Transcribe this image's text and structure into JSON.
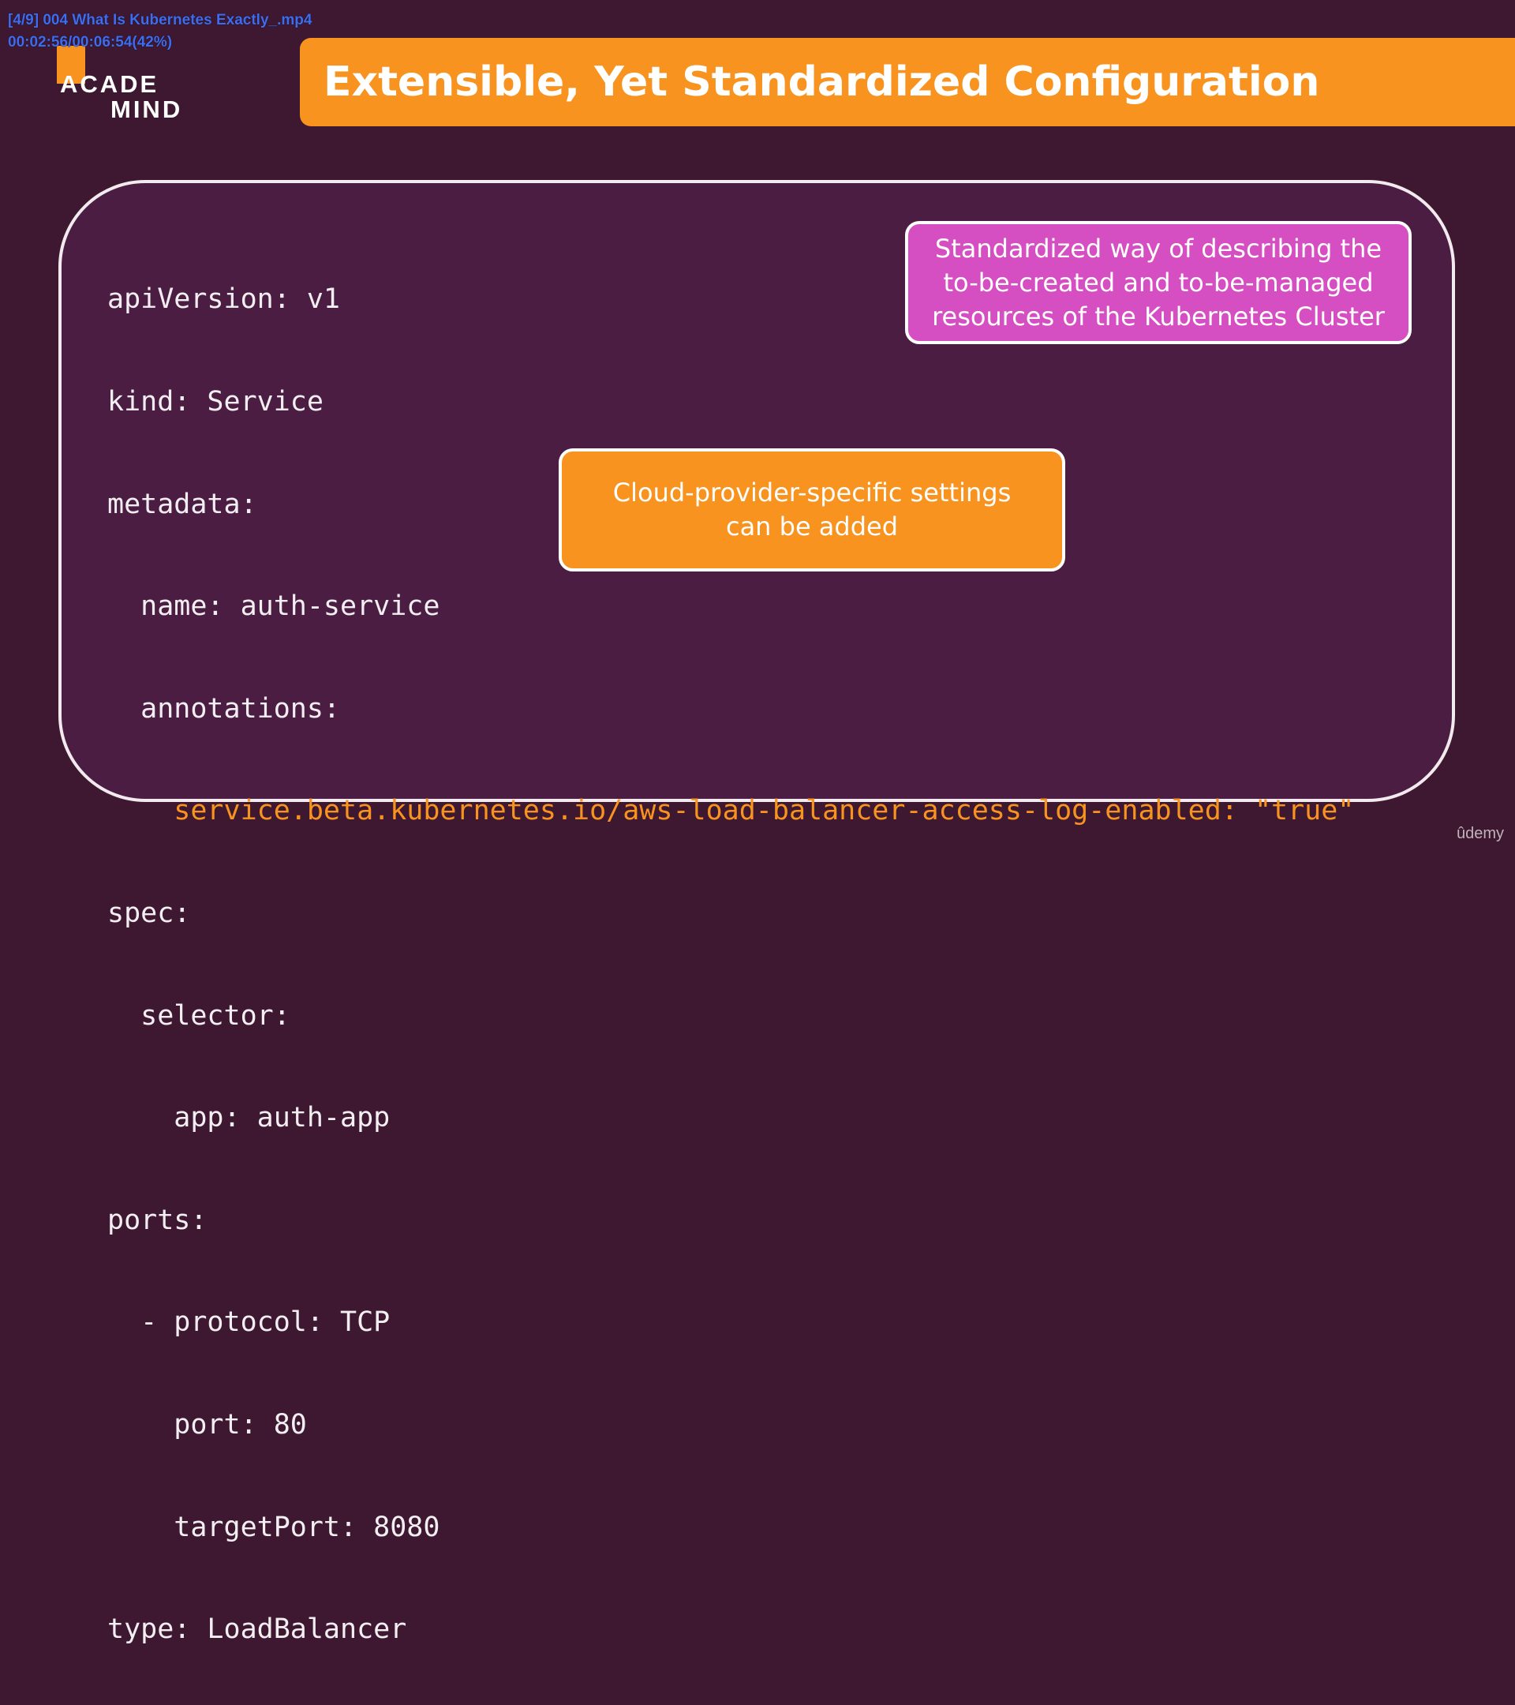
{
  "player": {
    "file_title": "[4/9] 004 What Is Kubernetes Exactly_.mp4",
    "time_status": "00:02:56/00:06:54(42%)"
  },
  "logo": {
    "line1": "ACADE",
    "line2": "MIND",
    "accent_color": "#f7931e"
  },
  "slide": {
    "title": "Extensible, Yet Standardized Configuration",
    "code_lines": [
      "apiVersion: v1",
      "kind: Service",
      "metadata:",
      "  name: auth-service",
      "  annotations:",
      "    service.beta.kubernetes.io/aws-load-balancer-access-log-enabled: \"true\"",
      "spec:",
      "  selector:",
      "    app: auth-app",
      "ports:",
      "  - protocol: TCP",
      "    port: 80",
      "    targetPort: 8080",
      "type: LoadBalancer",
      "..."
    ],
    "callout_pink": {
      "line1": "Standardized way of describing the",
      "line2": "to-be-created and to-be-managed",
      "line3": "resources of the Kubernetes Cluster",
      "color": "#d64fc2"
    },
    "callout_orange": {
      "line1": "Cloud-provider-specific settings",
      "line2": "can be added",
      "color": "#f7931e"
    }
  },
  "watermark": {
    "brand": "ûdemy"
  },
  "colors": {
    "background": "#3d1830",
    "panel": "#4b1d42",
    "accent_orange": "#f7931e",
    "accent_pink": "#d64fc2",
    "overlay_text": "#3d6cf0"
  }
}
